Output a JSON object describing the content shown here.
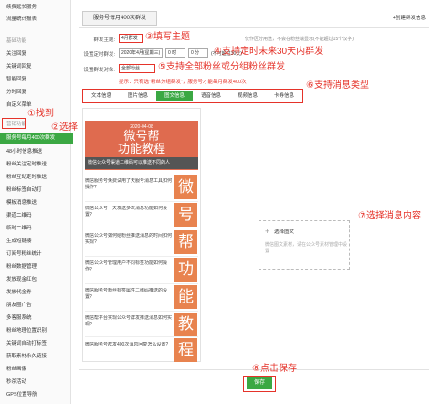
{
  "sidebar": {
    "items": [
      {
        "label": "续费延长服务",
        "group": false
      },
      {
        "label": "流量统计报表",
        "group": false
      },
      {
        "label": "基础功能",
        "group": true
      },
      {
        "label": "关注回复",
        "group": false
      },
      {
        "label": "关键词回复",
        "group": false
      },
      {
        "label": "智能回复",
        "group": false
      },
      {
        "label": "分时回复",
        "group": false
      },
      {
        "label": "自定义菜单",
        "group": false
      },
      {
        "label": "营销功能",
        "group": true
      },
      {
        "label": "服务号每月400次群发",
        "group": false,
        "active": true
      },
      {
        "label": "48小时信息推送",
        "group": false
      },
      {
        "label": "粉丝关注定时推送",
        "group": false
      },
      {
        "label": "粉丝互动定时推送",
        "group": false
      },
      {
        "label": "粉丝标签自动打",
        "group": false
      },
      {
        "label": "模板消息推送",
        "group": false
      },
      {
        "label": "渠道二维码",
        "group": false
      },
      {
        "label": "临时二维码",
        "group": false
      },
      {
        "label": "生成短链接",
        "group": false
      },
      {
        "label": "订阅号粉丝统计",
        "group": false
      },
      {
        "label": "粉丝数据管理",
        "group": false
      },
      {
        "label": "发放现金红包",
        "group": false
      },
      {
        "label": "发放代金券",
        "group": false
      },
      {
        "label": "朋友圈广告",
        "group": false
      },
      {
        "label": "多客服系统",
        "group": false
      },
      {
        "label": "粉丝地理位置识别",
        "group": false
      },
      {
        "label": "关键词自动打标签",
        "group": false
      },
      {
        "label": "获取素材永久链接",
        "group": false
      },
      {
        "label": "粉丝画像",
        "group": false
      },
      {
        "label": "秒杀活动",
        "group": false
      },
      {
        "label": "GPS位置导航",
        "group": false
      }
    ]
  },
  "header": {
    "tab_label": "服务号每月400次群发",
    "create_link": "+创建群发信息"
  },
  "form": {
    "theme_label": "群发主题:",
    "theme_value": "4月群发",
    "theme_hint": "仅作区分用途，不会在粉丝端显示(不能超过15个汉字)",
    "time_label": "设置定时群发:",
    "time_date": "2020年4月(星期三)",
    "time_hour": "0 时",
    "time_minute": "0 分",
    "time_hint": "(不可超过30天)",
    "target_label": "设置群发对象:",
    "target_value": "全部粉丝",
    "target_hint": "(可选择分组群发)",
    "tip": "提示：只有选\"粉丝分组群发\"，服务号才能每月群发400次"
  },
  "annotations": {
    "a1": "①找到",
    "a2": "②选择",
    "a3": "③填写主题",
    "a4": "④支持定时未来30天内群发",
    "a5": "⑤支持全部粉丝或分组粉丝群发",
    "a6": "⑥支持消息类型",
    "a7": "⑦选择消息内容",
    "a8": "⑧点击保存"
  },
  "tabs": [
    {
      "label": "文本信息",
      "active": false
    },
    {
      "label": "图片信息",
      "active": false
    },
    {
      "label": "图文信息",
      "active": true
    },
    {
      "label": "语音信息",
      "active": false
    },
    {
      "label": "视频信息",
      "active": false
    },
    {
      "label": "卡券信息",
      "active": false
    }
  ],
  "preview": {
    "date": "2020-04-08",
    "title_line1": "微号帮",
    "title_line2": "功能教程",
    "bar_text": "微信公众号渠道二维码可以推送不同的人",
    "items": [
      {
        "text": "微信服务号免费试用了天服号消息工具如何操作?",
        "thumb": "微"
      },
      {
        "text": "微信公众号一天发送多次消息功能如何设置?",
        "thumb": "号"
      },
      {
        "text": "微信公众号如何给粉丝推送消息的时间如何实现?",
        "thumb": "帮"
      },
      {
        "text": "微信公众号管理用户不同标签功能如何操作?",
        "thumb": "功"
      },
      {
        "text": "微信服务号粉丝标签属性二维码推送的设置?",
        "thumb": "能"
      },
      {
        "text": "微信帮平台实现公众号群发推送消息如何实现?",
        "thumb": "教"
      },
      {
        "text": "微信服务号群发400次消息回复怎么设置?",
        "thumb": "程"
      }
    ]
  },
  "select_panel": {
    "plus": "+",
    "title": "选择图文",
    "desc": "微信图文素材，请在公众号素材管理中设置"
  },
  "save_label": "保存",
  "colors": {
    "accent": "#3ba843",
    "annotation": "#e5332a",
    "cover": "#df6b4f",
    "thumb": "#e8834f"
  }
}
